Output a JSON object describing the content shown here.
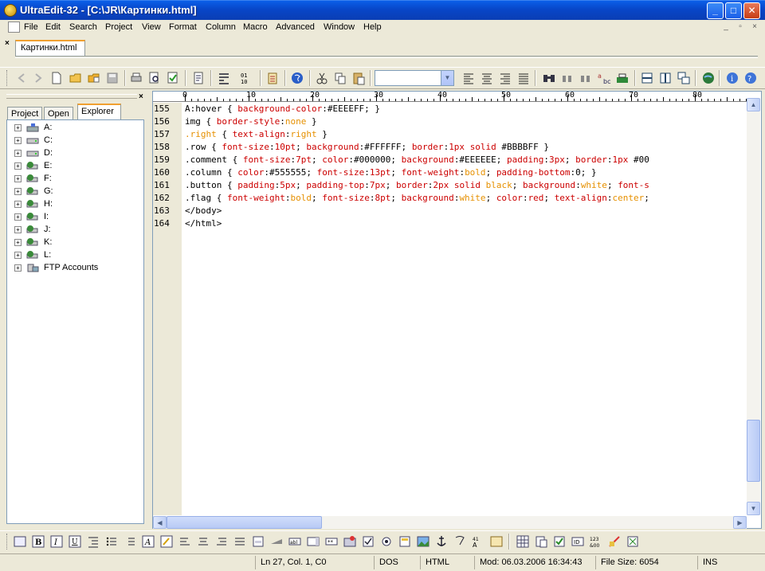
{
  "window": {
    "title": "UltraEdit-32 - [C:\\JR\\Картинки.html]",
    "minimize": "_",
    "maximize": "□",
    "close": "✕"
  },
  "menu": [
    "File",
    "Edit",
    "Search",
    "Project",
    "View",
    "Format",
    "Column",
    "Macro",
    "Advanced",
    "Window",
    "Help"
  ],
  "mdi_controls": [
    "_",
    "▫",
    "×"
  ],
  "tabs": {
    "close": "×",
    "file_tab": "Картинки.html"
  },
  "left_pane": {
    "close": "×",
    "tabs": [
      "Project",
      "Open",
      "Explorer"
    ],
    "active_tab": "Explorer",
    "tree": [
      "A:",
      "C:",
      "D:",
      "E:",
      "F:",
      "G:",
      "H:",
      "I:",
      "J:",
      "K:",
      "L:",
      "FTP Accounts"
    ],
    "expander": "+"
  },
  "ruler": {
    "labels": [
      "0",
      "10",
      "20",
      "30",
      "40",
      "50",
      "60",
      "70",
      "80"
    ]
  },
  "editor": {
    "line_numbers": [
      "155",
      "156",
      "157",
      "158",
      "159",
      "160",
      "161",
      "162",
      "163",
      "164"
    ],
    "lines": [
      [
        [
          "sel",
          "A:hover { "
        ],
        [
          "prop",
          "background-color"
        ],
        [
          "pb",
          ":#EEEEFF; }"
        ]
      ],
      [
        [
          "sel",
          "img { "
        ],
        [
          "prop",
          "border-style"
        ],
        [
          "pb",
          ":"
        ],
        [
          "val",
          "none"
        ],
        [
          "pb",
          " }"
        ]
      ],
      [
        [
          "val",
          ".right"
        ],
        [
          "pb",
          " { "
        ],
        [
          "prop",
          "text-align"
        ],
        [
          "pb",
          ":"
        ],
        [
          "val",
          "right"
        ],
        [
          "pb",
          " }"
        ]
      ],
      [
        [
          "sel",
          ".row { "
        ],
        [
          "prop",
          "font-size"
        ],
        [
          "pb",
          ":"
        ],
        [
          "num",
          "10pt"
        ],
        [
          "pb",
          "; "
        ],
        [
          "prop",
          "background"
        ],
        [
          "pb",
          ":#FFFFFF; "
        ],
        [
          "prop",
          "border"
        ],
        [
          "pb",
          ":"
        ],
        [
          "num",
          "1px"
        ],
        [
          "pb",
          " "
        ],
        [
          "prop",
          "solid"
        ],
        [
          "pb",
          " #BBBBFF }"
        ]
      ],
      [
        [
          "sel",
          ".comment { "
        ],
        [
          "prop",
          "font-size"
        ],
        [
          "pb",
          ":"
        ],
        [
          "num",
          "7pt"
        ],
        [
          "pb",
          "; "
        ],
        [
          "prop",
          "color"
        ],
        [
          "pb",
          ":#000000; "
        ],
        [
          "prop",
          "background"
        ],
        [
          "pb",
          ":#EEEEEE; "
        ],
        [
          "prop",
          "padding"
        ],
        [
          "pb",
          ":"
        ],
        [
          "num",
          "3px"
        ],
        [
          "pb",
          "; "
        ],
        [
          "prop",
          "border"
        ],
        [
          "pb",
          ":"
        ],
        [
          "num",
          "1px"
        ],
        [
          "pb",
          " #00"
        ]
      ],
      [
        [
          "sel",
          ".column { "
        ],
        [
          "prop",
          "color"
        ],
        [
          "pb",
          ":#555555; "
        ],
        [
          "prop",
          "font-size"
        ],
        [
          "pb",
          ":"
        ],
        [
          "num",
          "13pt"
        ],
        [
          "pb",
          "; "
        ],
        [
          "prop",
          "font-weight"
        ],
        [
          "pb",
          ":"
        ],
        [
          "val",
          "bold"
        ],
        [
          "pb",
          "; "
        ],
        [
          "prop",
          "padding-bottom"
        ],
        [
          "pb",
          ":0; }"
        ]
      ],
      [
        [
          "sel",
          ".button { "
        ],
        [
          "prop",
          "padding"
        ],
        [
          "pb",
          ":"
        ],
        [
          "num",
          "5px"
        ],
        [
          "pb",
          "; "
        ],
        [
          "prop",
          "padding-top"
        ],
        [
          "pb",
          ":"
        ],
        [
          "num",
          "7px"
        ],
        [
          "pb",
          "; "
        ],
        [
          "prop",
          "border"
        ],
        [
          "pb",
          ":"
        ],
        [
          "num",
          "2px"
        ],
        [
          "pb",
          " "
        ],
        [
          "prop",
          "solid"
        ],
        [
          "pb",
          " "
        ],
        [
          "val",
          "black"
        ],
        [
          "pb",
          "; "
        ],
        [
          "prop",
          "background"
        ],
        [
          "pb",
          ":"
        ],
        [
          "val",
          "white"
        ],
        [
          "pb",
          "; "
        ],
        [
          "prop",
          "font-s"
        ]
      ],
      [
        [
          "sel",
          ".flag { "
        ],
        [
          "prop",
          "font-weight"
        ],
        [
          "pb",
          ":"
        ],
        [
          "val",
          "bold"
        ],
        [
          "pb",
          "; "
        ],
        [
          "prop",
          "font-size"
        ],
        [
          "pb",
          ":"
        ],
        [
          "num",
          "8pt"
        ],
        [
          "pb",
          "; "
        ],
        [
          "prop",
          "background"
        ],
        [
          "pb",
          ":"
        ],
        [
          "val",
          "white"
        ],
        [
          "pb",
          "; "
        ],
        [
          "prop",
          "color"
        ],
        [
          "pb",
          ":"
        ],
        [
          "num",
          "red"
        ],
        [
          "pb",
          "; "
        ],
        [
          "prop",
          "text-align"
        ],
        [
          "pb",
          ":"
        ],
        [
          "val",
          "center"
        ],
        [
          "pb",
          ";"
        ]
      ],
      [
        [
          "tag",
          "</body>"
        ]
      ],
      [
        [
          "tag",
          "</html>"
        ]
      ]
    ],
    "scroll_up": "▲",
    "scroll_down": "▼",
    "scroll_left": "◀",
    "scroll_right": "▶"
  },
  "status": {
    "position": "Ln 27, Col. 1, C0",
    "line_ending": "DOS",
    "syntax": "HTML",
    "modified": "Mod: 06.03.2006 16:34:43",
    "file_size": "File Size: 6054",
    "insert_mode": "INS"
  },
  "colors": {
    "keyword": "#cc0000",
    "value": "#e69000",
    "title_bar": "#0846c8"
  }
}
